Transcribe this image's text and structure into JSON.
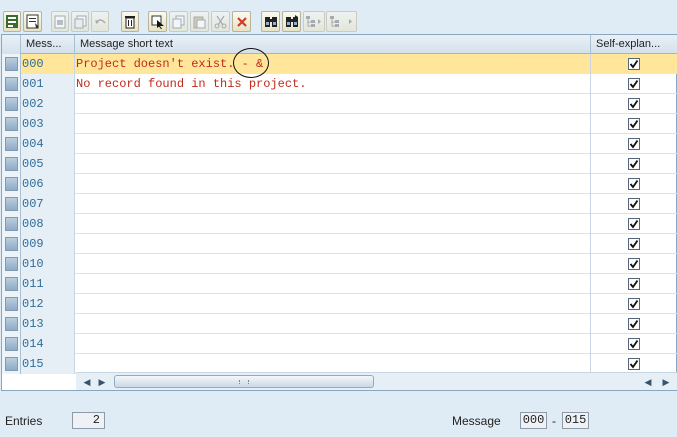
{
  "toolbar": {
    "buttons": [
      {
        "icon": "select-layout-icon"
      },
      {
        "icon": "save-layout-icon"
      },
      {
        "icon": "create-entry-icon"
      },
      {
        "icon": "copy-entry-icon"
      },
      {
        "icon": "undo-icon"
      },
      {
        "icon": "delete-icon"
      },
      {
        "icon": "select-all-icon"
      },
      {
        "icon": "copy-icon"
      },
      {
        "icon": "paste-icon"
      },
      {
        "icon": "cut-icon"
      },
      {
        "icon": "deselect-icon"
      },
      {
        "icon": "find-icon"
      },
      {
        "icon": "find-next-icon"
      },
      {
        "icon": "expand-icon"
      },
      {
        "icon": "collapse-icon"
      }
    ]
  },
  "table": {
    "columns": [
      "Mess...",
      "Message short text",
      "Self-explan..."
    ],
    "rows": [
      {
        "number": "000",
        "text": "Project doesn't exist. - &",
        "self_explanatory": true
      },
      {
        "number": "001",
        "text": "No record found in this project.",
        "self_explanatory": true
      },
      {
        "number": "002",
        "text": "",
        "self_explanatory": true
      },
      {
        "number": "003",
        "text": "",
        "self_explanatory": true
      },
      {
        "number": "004",
        "text": "",
        "self_explanatory": true
      },
      {
        "number": "005",
        "text": "",
        "self_explanatory": true
      },
      {
        "number": "006",
        "text": "",
        "self_explanatory": true
      },
      {
        "number": "007",
        "text": "",
        "self_explanatory": true
      },
      {
        "number": "008",
        "text": "",
        "self_explanatory": true
      },
      {
        "number": "009",
        "text": "",
        "self_explanatory": true
      },
      {
        "number": "010",
        "text": "",
        "self_explanatory": true
      },
      {
        "number": "011",
        "text": "",
        "self_explanatory": true
      },
      {
        "number": "012",
        "text": "",
        "self_explanatory": true
      },
      {
        "number": "013",
        "text": "",
        "self_explanatory": true
      },
      {
        "number": "014",
        "text": "",
        "self_explanatory": true
      },
      {
        "number": "015",
        "text": "",
        "self_explanatory": true
      }
    ]
  },
  "scroll": {
    "left": "◀",
    "right": "▶"
  },
  "footer": {
    "entries_label": "Entries",
    "entries_value": "2",
    "message_label": "Message",
    "message_from": "000",
    "separator": "-",
    "message_to": "015"
  },
  "colors": {
    "highlight": "#ffe69a",
    "message_text": "#c02a1d",
    "number_text": "#2f6e99"
  }
}
